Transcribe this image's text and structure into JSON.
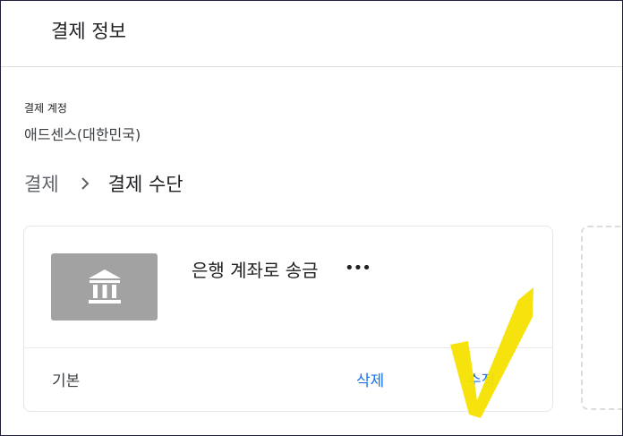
{
  "header": {
    "title": "결제 정보"
  },
  "account": {
    "label": "결제 계정",
    "value": "애드센스(대한민국)"
  },
  "breadcrumb": {
    "parent": "결제",
    "separator_icon": "chevron-right-icon",
    "current": "결제 수단"
  },
  "payment_method": {
    "icon": "bank-icon",
    "title": "은행 계좌로 송금",
    "masked_suffix": "•••",
    "default_label": "기본",
    "delete_label": "삭제",
    "edit_label": "수정"
  },
  "colors": {
    "link": "#1a73e8",
    "bank_tile": "#a2a2a2",
    "annotation_checkmark": "#f5e100"
  }
}
